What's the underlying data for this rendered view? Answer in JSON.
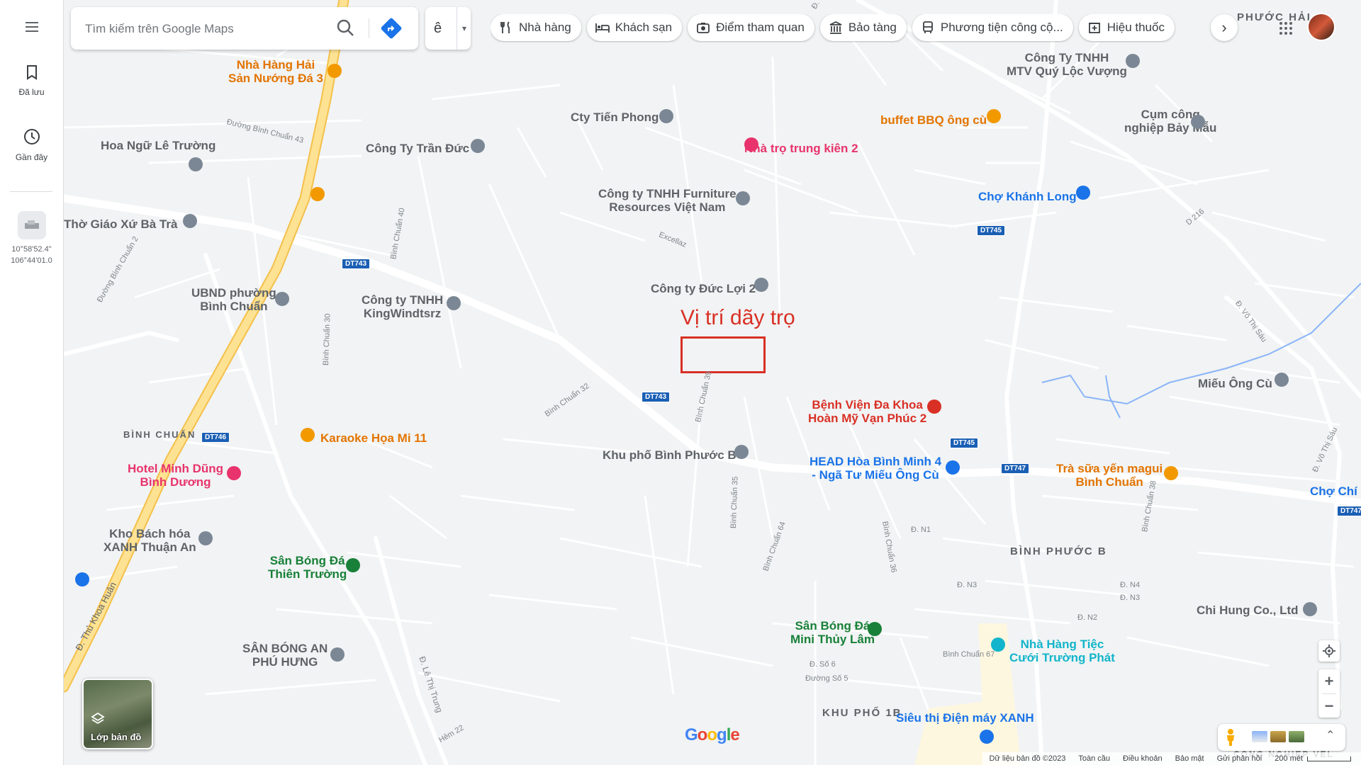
{
  "rail": {
    "menu_icon": "hamburger-menu-icon",
    "saved_label": "Đã lưu",
    "recent_label": "Gần đây",
    "coord_lat": "10°58'52.4\"",
    "coord_lng": "106°44'01.0"
  },
  "search": {
    "placeholder": "Tìm kiếm trên Google Maps",
    "value": ""
  },
  "language": {
    "text": "ê"
  },
  "chips": [
    {
      "label": "Nhà hàng",
      "icon": "fork-knife-icon"
    },
    {
      "label": "Khách sạn",
      "icon": "bed-icon"
    },
    {
      "label": "Điểm tham quan",
      "icon": "camera-icon"
    },
    {
      "label": "Bảo tàng",
      "icon": "museum-icon"
    },
    {
      "label": "Phương tiện công cộ...",
      "icon": "bus-icon"
    },
    {
      "label": "Hiệu thuốc",
      "icon": "pharmacy-icon"
    }
  ],
  "annotation": {
    "label": "Vị trí dãy trọ",
    "color": "#d93025"
  },
  "pois": [
    {
      "label": "Nhà Hàng Hải\nSản Nướng Đá 3",
      "kind": "orange"
    },
    {
      "label": "Hoa Ngữ Lê Trường",
      "kind": "gray"
    },
    {
      "label": "Công Ty Trần Đức",
      "kind": "gray"
    },
    {
      "label": "Cty Tiến Phong",
      "kind": "gray"
    },
    {
      "label": "Nhà trọ trung kiên 2",
      "kind": "pink"
    },
    {
      "label": "Công Ty TNHH\nMTV Quý Lộc Vượng",
      "kind": "gray"
    },
    {
      "label": "buffet BBQ ông cù",
      "kind": "orange"
    },
    {
      "label": "Cụm công\nnghiệp Bảy Mẫu",
      "kind": "gray"
    },
    {
      "label": "Công ty TNHH Furniture\nResources Việt Nam",
      "kind": "gray"
    },
    {
      "label": "Chợ Khánh Long",
      "kind": "blue"
    },
    {
      "label": "Thờ Giáo Xứ Bà Trà",
      "kind": "gray"
    },
    {
      "label": "Công ty Đức Lợi 2",
      "kind": "gray"
    },
    {
      "label": "UBND phường\nBình Chuẩn",
      "kind": "gray"
    },
    {
      "label": "Công ty TNHH\nKingWindtsrz",
      "kind": "gray"
    },
    {
      "label": "Miếu Ông Cù",
      "kind": "gray"
    },
    {
      "label": "Bệnh Viện Đa Khoa\nHoàn Mỹ Vạn Phúc 2",
      "kind": "red"
    },
    {
      "label": "Karaoke Họa Mi 11",
      "kind": "orange"
    },
    {
      "label": "Khu phố Bình Phước B",
      "kind": "gray"
    },
    {
      "label": "HEAD Hòa Bình Minh 4\n- Ngã Tư Miếu Ông Cù",
      "kind": "blue"
    },
    {
      "label": "Trà sữa yến magui\nBình Chuẩn",
      "kind": "orange"
    },
    {
      "label": "Chợ Chí H",
      "kind": "blue"
    },
    {
      "label": "Hotel Minh Dũng\nBình Dương",
      "kind": "pink"
    },
    {
      "label": "Kho Bách hóa\nXANH Thuận An",
      "kind": "gray"
    },
    {
      "label": "Sân Bóng Đá\nThiên Trường",
      "kind": "green"
    },
    {
      "label": "Chi Hung Co., Ltd",
      "kind": "gray"
    },
    {
      "label": "Sân Bóng Đá\nMini Thủy Lâm",
      "kind": "green"
    },
    {
      "label": "Nhà Hàng Tiệc\nCưới Trường Phát",
      "kind": "teal"
    },
    {
      "label": "SÂN BÓNG AN\nPHÚ HƯNG",
      "kind": "gray"
    },
    {
      "label": "Siêu thị Điện máy XANH",
      "kind": "blue"
    }
  ],
  "districts": [
    "BÌNH CHUẨN",
    "BÌNH PHƯỚC B",
    "KHU PHỐ 1B",
    "PHƯỚC HẢI",
    "CÔNG NGHIỆP VÉL"
  ],
  "streets": [
    "Đường Bình Chuẩn 43",
    "Bình Chuẩn 40",
    "Đường Bình Chuẩn 2",
    "Bình Chuẩn 30",
    "Excellaz",
    "Bình Chuẩn 32",
    "Bình Chuẩn 39",
    "Bình Chuẩn 35",
    "Bình Chuẩn 64",
    "Bình Chuẩn 36",
    "Bình Chuẩn 38",
    "Đ. Võ Thị Sáu",
    "Đ. Võ Thị Sáu",
    "D 216",
    "Đ. Thủ Khoa Huân",
    "Đ. Lê Thị Trung",
    "Hẻm 22",
    "Đ. N1",
    "Đ. N3",
    "Đ. N4",
    "Đ. N3",
    "Đ. N2",
    "Bình Chuẩn 67",
    "Đ. Số 6",
    "Đường Số 5",
    "Đ. Võ Th"
  ],
  "shields": [
    "DT743",
    "DT743",
    "DT746",
    "DT745",
    "DT745",
    "DT747",
    "DT747"
  ],
  "footer": {
    "data": "Dữ liệu bản đồ ©2023",
    "global": "Toàn cầu",
    "terms": "Điều khoản",
    "privacy": "Bảo mật",
    "feedback": "Gửi phản hồi",
    "scale": "200 mét"
  },
  "layers_label": "Lớp bản đồ",
  "logo": "Google",
  "colors": {
    "road_main": "#fde293",
    "road_main_edge": "#f5c04a",
    "road": "#ffffff",
    "map_bg": "#f1f3f4",
    "water": "#8ab4f8"
  }
}
